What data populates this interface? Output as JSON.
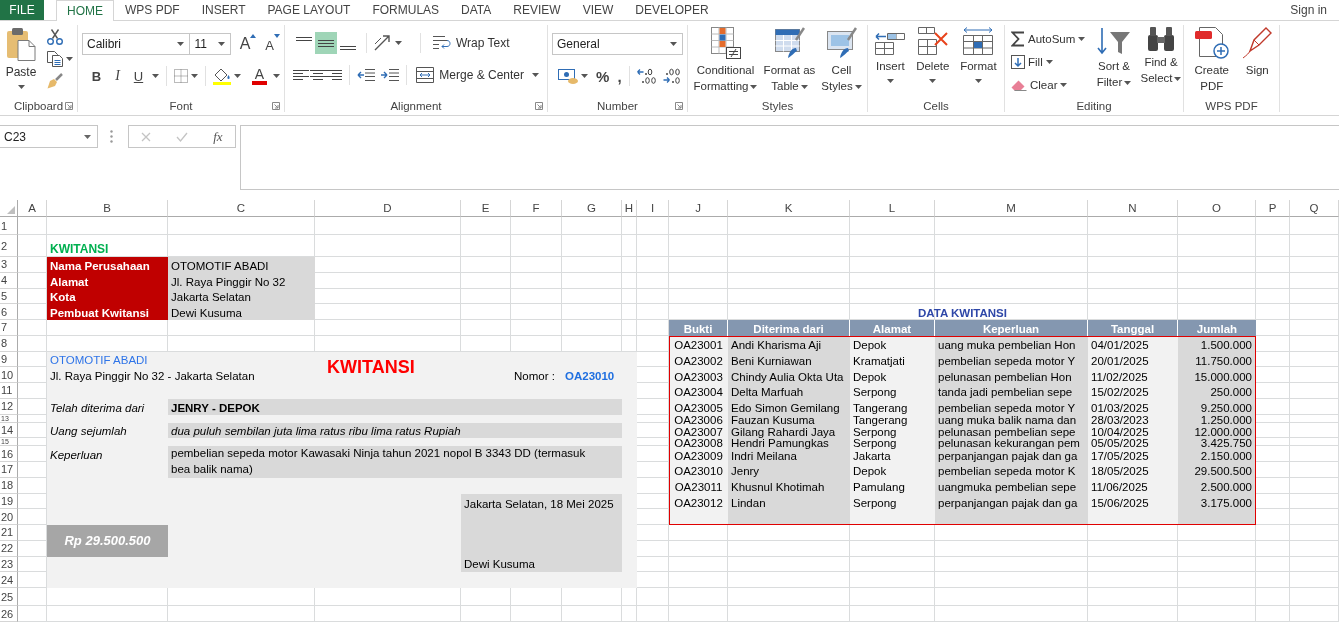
{
  "tabs": [
    {
      "label": "FILE",
      "kind": "file",
      "selected": false
    },
    {
      "label": "HOME",
      "kind": "tab",
      "selected": true
    },
    {
      "label": "WPS PDF",
      "kind": "tab",
      "selected": false
    },
    {
      "label": "INSERT",
      "kind": "tab",
      "selected": false
    },
    {
      "label": "PAGE LAYOUT",
      "kind": "tab",
      "selected": false
    },
    {
      "label": "FORMULAS",
      "kind": "tab",
      "selected": false
    },
    {
      "label": "DATA",
      "kind": "tab",
      "selected": false
    },
    {
      "label": "REVIEW",
      "kind": "tab",
      "selected": false
    },
    {
      "label": "VIEW",
      "kind": "tab",
      "selected": false
    },
    {
      "label": "DEVELOPER",
      "kind": "tab",
      "selected": false
    }
  ],
  "sign_in": "Sign in",
  "ribbon": {
    "clipboard": {
      "label": "Clipboard",
      "paste": "Paste"
    },
    "font": {
      "label": "Font",
      "font_name": "Calibri",
      "font_size": "11",
      "grow": "A",
      "shrink": "A",
      "bold": "B",
      "italic": "I",
      "underline": "U",
      "font_color": "A"
    },
    "alignment": {
      "label": "Alignment",
      "vertical": [
        {
          "kind": "top",
          "selected": false
        },
        {
          "kind": "middle",
          "selected": true
        },
        {
          "kind": "bottom",
          "selected": false
        }
      ],
      "horizontal": [
        {
          "kind": "left",
          "selected": false
        },
        {
          "kind": "center",
          "selected": false
        },
        {
          "kind": "right",
          "selected": false
        }
      ],
      "wrap_text": "Wrap Text",
      "merge": "Merge & Center"
    },
    "number": {
      "label": "Number",
      "format": "General",
      "percent": "%",
      "comma": ","
    },
    "styles": {
      "label": "Styles",
      "buttons": [
        {
          "kind": "conditional",
          "label": "Conditional Formatting"
        },
        {
          "kind": "table",
          "label": "Format as Table"
        },
        {
          "kind": "cell",
          "label": "Cell Styles"
        }
      ]
    },
    "cells": {
      "label": "Cells",
      "buttons": [
        {
          "kind": "insert",
          "label": "Insert"
        },
        {
          "kind": "delete",
          "label": "Delete"
        },
        {
          "kind": "format",
          "label": "Format"
        }
      ]
    },
    "editing": {
      "label": "Editing",
      "commands": [
        {
          "kind": "sum",
          "label": "AutoSum"
        },
        {
          "kind": "fill",
          "label": "Fill"
        },
        {
          "kind": "clear",
          "label": "Clear"
        }
      ],
      "buttons": [
        {
          "kind": "sort",
          "label": "Sort & Filter"
        },
        {
          "kind": "find",
          "label": "Find & Select"
        }
      ]
    },
    "wps_pdf": {
      "label": "WPS PDF",
      "buttons": [
        {
          "kind": "create",
          "label": "Create PDF"
        },
        {
          "kind": "sign",
          "label": "Sign"
        }
      ]
    }
  },
  "formula_bar": {
    "name_box": "C23",
    "editing": false,
    "function_button": "fx"
  },
  "sheet": {
    "columns": [
      "A",
      "B",
      "C",
      "D",
      "E",
      "F",
      "G",
      "H",
      "I",
      "J",
      "K",
      "L",
      "M",
      "N",
      "O",
      "P",
      "Q"
    ],
    "rows": [
      "1",
      "2",
      "3",
      "4",
      "5",
      "6",
      "7",
      "8",
      "9",
      "10",
      "11",
      "12",
      "13",
      "14",
      "15",
      "16",
      "17",
      "18",
      "19",
      "20",
      "21",
      "22",
      "23",
      "24",
      "25",
      "26"
    ],
    "info": {
      "title": "KWITANSI",
      "fields": [
        {
          "label": "Nama Perusahaan",
          "value": "OTOMOTIF ABADI"
        },
        {
          "label": "Alamat",
          "value": "Jl. Raya Pinggir No 32"
        },
        {
          "label": "Kota",
          "value": "Jakarta Selatan"
        },
        {
          "label": "Pembuat Kwitansi",
          "value": "Dewi Kusuma"
        }
      ]
    },
    "receipt": {
      "company": "OTOMOTIF ABADI",
      "title": "KWITANSI",
      "address": "Jl. Raya Pinggir No 32 - Jakarta Selatan",
      "number_label": "Nomor :",
      "number": "OA23010",
      "fields": [
        {
          "label": "Telah diterima dari",
          "value": "JENRY - DEPOK",
          "kind": "bold"
        },
        {
          "label": "Uang sejumlah",
          "value": "dua puluh sembilan juta lima ratus ribu lima ratus Rupiah",
          "kind": "italic"
        },
        {
          "label": "Keperluan",
          "value": "pembelian sepeda motor Kawasaki Ninja tahun 2021 nopol B 3343 DD (termasuk bea balik nama)",
          "kind": "plain"
        }
      ],
      "amount": "Rp 29.500.500",
      "place_date": "Jakarta Selatan, 18 Mei 2025",
      "signer": "Dewi Kusuma"
    },
    "data_table": {
      "title": "DATA KWITANSI",
      "columns": [
        "Bukti",
        "Diterima dari",
        "Alamat",
        "Keperluan",
        "Tanggal",
        "Jumlah"
      ],
      "rows": [
        [
          "OA23001",
          "Andi Kharisma Aji",
          "Depok",
          "uang muka pembelian Hon",
          "04/01/2025",
          "1.500.000"
        ],
        [
          "OA23002",
          "Beni Kurniawan",
          "Kramatjati",
          "pembelian sepeda motor Y",
          "20/01/2025",
          "11.750.000"
        ],
        [
          "OA23003",
          "Chindy Aulia Okta Uta",
          "Depok",
          "pelunasan pembelian Hon",
          "11/02/2025",
          "15.000.000"
        ],
        [
          "OA23004",
          "Delta Marfuah",
          "Serpong",
          "tanda jadi pembelian sepe",
          "15/02/2025",
          "250.000"
        ],
        [
          "OA23005",
          "Edo Simon Gemilang",
          "Tangerang",
          "pembelian sepeda motor Y",
          "01/03/2025",
          "9.250.000"
        ],
        [
          "OA23006",
          "Fauzan Kusuma",
          "Tangerang",
          "uang muka balik nama dan",
          "28/03/2023",
          "1.250.000"
        ],
        [
          "OA23007",
          "Gilang Rahardi Jaya",
          "Serpong",
          "pelunasan pembelian sepe",
          "10/04/2025",
          "12.000.000"
        ],
        [
          "OA23008",
          "Hendri Pamungkas",
          "Serpong",
          "pelunasan kekurangan pem",
          "05/05/2025",
          "3.425.750"
        ],
        [
          "OA23009",
          "Indri Meilana",
          "Jakarta",
          "perpanjangan pajak dan ga",
          "17/05/2025",
          "2.150.000"
        ],
        [
          "OA23010",
          "Jenry",
          "Depok",
          "pembelian sepeda motor K",
          "18/05/2025",
          "29.500.500"
        ],
        [
          "OA23011",
          "Khusnul Khotimah",
          "Pamulang",
          "uangmuka pembelian sepe",
          "11/06/2025",
          "2.500.000"
        ],
        [
          "OA23012",
          "Lindan",
          "Serpong",
          "perpanjangan pajak dan ga",
          "15/06/2025",
          "3.175.000"
        ]
      ]
    }
  }
}
